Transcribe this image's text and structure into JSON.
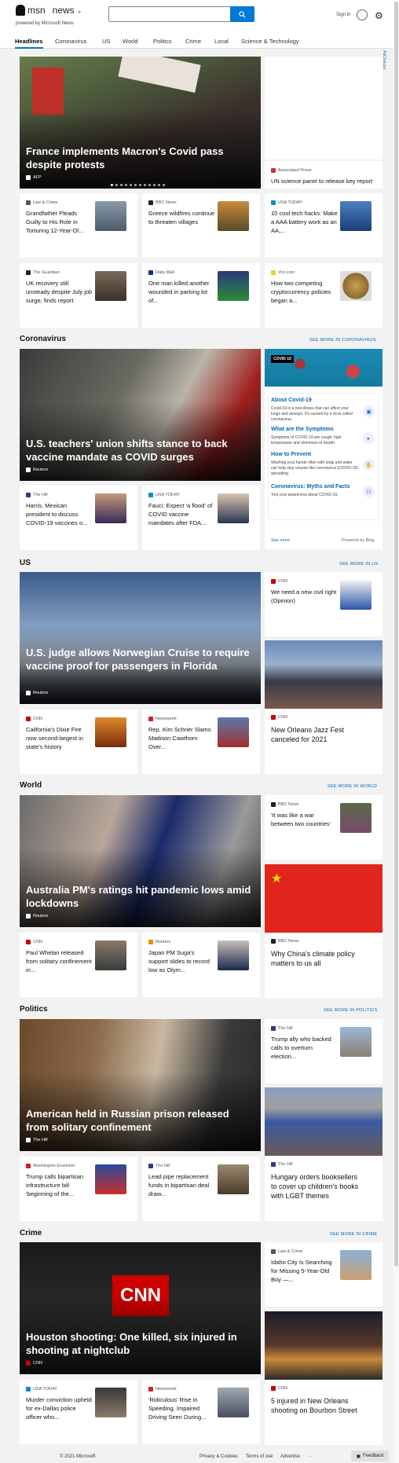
{
  "header": {
    "brand": "msn",
    "section": "news",
    "powered_by": "powered by Microsoft News",
    "search_placeholder": "",
    "signin": "Sign in"
  },
  "nav": [
    "Headlines",
    "Coronavirus",
    "US",
    "World",
    "Politics",
    "Crime",
    "Local",
    "Science & Technology"
  ],
  "ad": {
    "label": "AdChoices"
  },
  "headlines": {
    "hero": {
      "title": "France implements Macron's Covid pass despite protests",
      "source": "AFP"
    },
    "side": {
      "source": "Associated Press",
      "title": "UN science panel to release key report o..."
    },
    "cards": [
      {
        "source": "Law & Crime",
        "title": "Grandfather Pleads Guilty to His Role in Torturing 12-Year-Ol..."
      },
      {
        "source": "BBC News",
        "title": "Greece wildfires continue to threaten villages"
      },
      {
        "source": "USA TODAY",
        "title": "10 cool tech hacks: Make a AAA battery work as an AA,..."
      },
      {
        "source": "The Guardian",
        "title": "UK recovery still unsteady despite July job surge, finds report"
      },
      {
        "source": "Daily Mail",
        "title": "One man killed another wounded in parking lot of..."
      },
      {
        "source": "Vox.com",
        "title": "How two competing cryptocurrency policies began a..."
      }
    ]
  },
  "coronavirus": {
    "title": "Coronavirus",
    "see_more": "SEE MORE IN CORONAVIRUS",
    "hero": {
      "title": "U.S. teachers' union shifts stance to back vaccine mandate as COVID surges",
      "source": "Reuters"
    },
    "cards": [
      {
        "source": "The Hill",
        "title": "Harris, Mexican president to discuss COVID-19 vaccines o..."
      },
      {
        "source": "USA TODAY",
        "title": "Fauci: Expect 'a flood' of COVID vaccine mandates after FDA..."
      }
    ],
    "panel": {
      "tag": "COVID 19",
      "items": [
        {
          "heading": "About Covid-19",
          "text": "Covid-19 is a new illness that can affect your lungs and airways. It's caused by a virus called coronavirus."
        },
        {
          "heading": "What are the Symptoms",
          "text": "Symptoms of COVID-19 are cough, high temperature and shortness of breath."
        },
        {
          "heading": "How to Prevent",
          "text": "Washing your hands often with soap and water can help stop viruses like coronavirus (COVID-19) spreading."
        },
        {
          "heading": "Coronavirus: Myths and Facts",
          "text": "Test your awareness about COVID-19."
        }
      ],
      "see_more": "See more",
      "powered": "Powered by Bing"
    }
  },
  "us": {
    "title": "US",
    "see_more": "SEE MORE IN US",
    "hero": {
      "title": "U.S. judge allows Norwegian Cruise to require vaccine proof for passengers in Florida",
      "source": "Reuters"
    },
    "side": {
      "source": "CNN",
      "title": "We need a new civil right (Opinion)"
    },
    "big": {
      "source": "CNN",
      "title": "New Orleans Jazz Fest canceled for 2021"
    },
    "cards": [
      {
        "source": "CNN",
        "title": "California's Dixie Fire now second-largest in state's history"
      },
      {
        "source": "Newsweek",
        "title": "Rep. Kim Schrier Slams Madison Cawthorn Over..."
      }
    ]
  },
  "world": {
    "title": "World",
    "see_more": "SEE MORE IN WORLD",
    "hero": {
      "title": "Australia PM's ratings hit pandemic lows amid lockdowns",
      "source": "Reuters"
    },
    "side": {
      "source": "BBC News",
      "title": "'It was like a war between two countries'"
    },
    "big": {
      "source": "BBC News",
      "title": "Why China's climate policy matters to us all"
    },
    "cards": [
      {
        "source": "CNN",
        "title": "Paul Whelan released from solitary confinement in..."
      },
      {
        "source": "Reuters",
        "title": "Japan PM Suga's support slides to record low as Olym..."
      }
    ]
  },
  "politics": {
    "title": "Politics",
    "see_more": "SEE MORE IN POLITICS",
    "hero": {
      "title": "American held in Russian prison released from solitary confinement",
      "source": "The Hill"
    },
    "side": {
      "source": "The Hill",
      "title": "Trump ally who backed calls to overturn election..."
    },
    "big": {
      "source": "The Hill",
      "title": "Hungary orders booksellers to cover up children's books with LGBT themes"
    },
    "cards": [
      {
        "source": "Washington Examiner",
        "title": "Trump calls bipartisan infrastructure bill 'beginning of the..."
      },
      {
        "source": "The Hill",
        "title": "Lead pipe replacement funds in bipartisan deal draw..."
      }
    ]
  },
  "crime": {
    "title": "Crime",
    "see_more": "SEE MORE IN CRIME",
    "hero": {
      "title": "Houston shooting: One killed, six injured in shooting at nightclub",
      "source": "CNN",
      "logo": "CNN"
    },
    "side": {
      "source": "Law & Crime",
      "title": "Idaho City Is Searching for Missing 5-Year-Old Boy —..."
    },
    "big": {
      "source": "CNN",
      "title": "5 injured in New Orleans shooting on Bourbon Street"
    },
    "cards": [
      {
        "source": "USA TODAY",
        "title": "Murder conviction upheld for ex-Dallas police officer who..."
      },
      {
        "source": "Newsweek",
        "title": "'Ridiculous' Rise in Speeding, Impaired Driving Seen During..."
      }
    ]
  },
  "footer": {
    "copyright": "© 2021 Microsoft",
    "privacy": "Privacy & Cookies",
    "terms": "Terms of use",
    "advertise": "Advertise",
    "more": "· · ·",
    "feedback": "Feedback"
  }
}
